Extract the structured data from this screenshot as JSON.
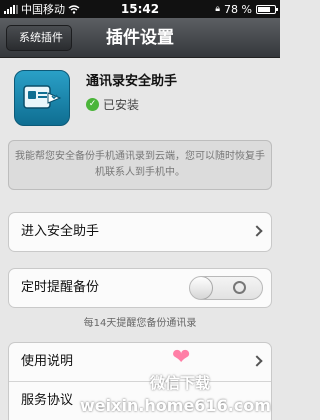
{
  "status_bar": {
    "carrier": "中国移动",
    "time": "15:42",
    "battery": "78 %",
    "battery_level": 0.78
  },
  "nav": {
    "back_label": "系统插件",
    "title": "插件设置"
  },
  "plugin": {
    "name": "通讯录安全助手",
    "status": "已安装",
    "icon": "contacts-backup-icon",
    "description": "我能帮您安全备份手机通讯录到云端，您可以随时恢复手机联系人到手机中。"
  },
  "rows": {
    "enter_label": "进入安全助手",
    "reminder_label": "定时提醒备份",
    "reminder_hint": "每14天提醒您备份通讯录",
    "usage_label": "使用说明",
    "terms_label": "服务协议"
  },
  "watermark": {
    "line1": "微信下载",
    "line2": "weixin.home616.com"
  },
  "colors": {
    "nav_bg": "#45484c",
    "installed_green": "#4bb53a",
    "icon_blue": "#1a87b0"
  }
}
